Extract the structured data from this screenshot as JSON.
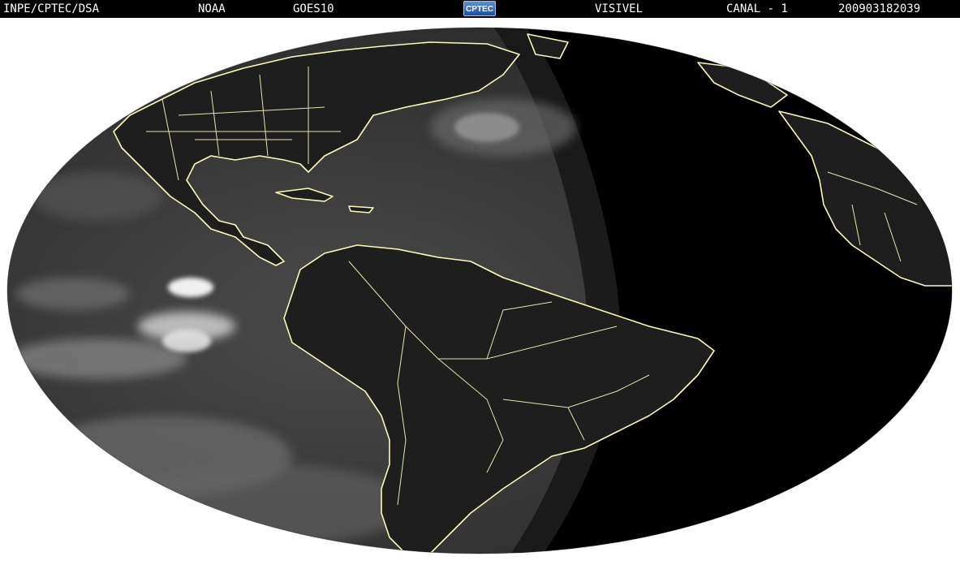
{
  "header": {
    "org": "INPE/CPTEC/DSA",
    "agency": "NOAA",
    "satellite": "GOES10",
    "logo_text": "CPTEC",
    "channel_type": "VISIVEL",
    "channel": "CANAL - 1",
    "timestamp": "200903182039"
  },
  "map": {
    "projection": "elliptical full-disk",
    "colors": {
      "ocean_day": "#3a3a3a",
      "night": "#000000",
      "borders": "#fff8c0",
      "clouds": "#cfcfcf",
      "background": "#ffffff"
    }
  }
}
